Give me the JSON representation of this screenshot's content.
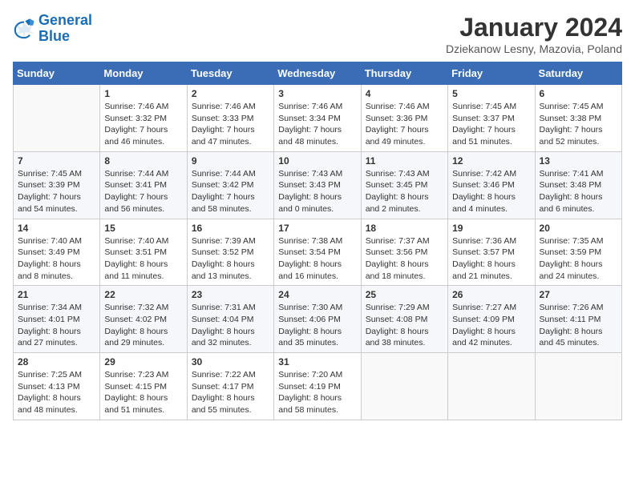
{
  "header": {
    "logo_general": "General",
    "logo_blue": "Blue",
    "month_title": "January 2024",
    "location": "Dziekanow Lesny, Mazovia, Poland"
  },
  "days_of_week": [
    "Sunday",
    "Monday",
    "Tuesday",
    "Wednesday",
    "Thursday",
    "Friday",
    "Saturday"
  ],
  "weeks": [
    [
      {
        "day": "",
        "sunrise": "",
        "sunset": "",
        "daylight": ""
      },
      {
        "day": "1",
        "sunrise": "Sunrise: 7:46 AM",
        "sunset": "Sunset: 3:32 PM",
        "daylight": "Daylight: 7 hours and 46 minutes."
      },
      {
        "day": "2",
        "sunrise": "Sunrise: 7:46 AM",
        "sunset": "Sunset: 3:33 PM",
        "daylight": "Daylight: 7 hours and 47 minutes."
      },
      {
        "day": "3",
        "sunrise": "Sunrise: 7:46 AM",
        "sunset": "Sunset: 3:34 PM",
        "daylight": "Daylight: 7 hours and 48 minutes."
      },
      {
        "day": "4",
        "sunrise": "Sunrise: 7:46 AM",
        "sunset": "Sunset: 3:36 PM",
        "daylight": "Daylight: 7 hours and 49 minutes."
      },
      {
        "day": "5",
        "sunrise": "Sunrise: 7:45 AM",
        "sunset": "Sunset: 3:37 PM",
        "daylight": "Daylight: 7 hours and 51 minutes."
      },
      {
        "day": "6",
        "sunrise": "Sunrise: 7:45 AM",
        "sunset": "Sunset: 3:38 PM",
        "daylight": "Daylight: 7 hours and 52 minutes."
      }
    ],
    [
      {
        "day": "7",
        "sunrise": "Sunrise: 7:45 AM",
        "sunset": "Sunset: 3:39 PM",
        "daylight": "Daylight: 7 hours and 54 minutes."
      },
      {
        "day": "8",
        "sunrise": "Sunrise: 7:44 AM",
        "sunset": "Sunset: 3:41 PM",
        "daylight": "Daylight: 7 hours and 56 minutes."
      },
      {
        "day": "9",
        "sunrise": "Sunrise: 7:44 AM",
        "sunset": "Sunset: 3:42 PM",
        "daylight": "Daylight: 7 hours and 58 minutes."
      },
      {
        "day": "10",
        "sunrise": "Sunrise: 7:43 AM",
        "sunset": "Sunset: 3:43 PM",
        "daylight": "Daylight: 8 hours and 0 minutes."
      },
      {
        "day": "11",
        "sunrise": "Sunrise: 7:43 AM",
        "sunset": "Sunset: 3:45 PM",
        "daylight": "Daylight: 8 hours and 2 minutes."
      },
      {
        "day": "12",
        "sunrise": "Sunrise: 7:42 AM",
        "sunset": "Sunset: 3:46 PM",
        "daylight": "Daylight: 8 hours and 4 minutes."
      },
      {
        "day": "13",
        "sunrise": "Sunrise: 7:41 AM",
        "sunset": "Sunset: 3:48 PM",
        "daylight": "Daylight: 8 hours and 6 minutes."
      }
    ],
    [
      {
        "day": "14",
        "sunrise": "Sunrise: 7:40 AM",
        "sunset": "Sunset: 3:49 PM",
        "daylight": "Daylight: 8 hours and 8 minutes."
      },
      {
        "day": "15",
        "sunrise": "Sunrise: 7:40 AM",
        "sunset": "Sunset: 3:51 PM",
        "daylight": "Daylight: 8 hours and 11 minutes."
      },
      {
        "day": "16",
        "sunrise": "Sunrise: 7:39 AM",
        "sunset": "Sunset: 3:52 PM",
        "daylight": "Daylight: 8 hours and 13 minutes."
      },
      {
        "day": "17",
        "sunrise": "Sunrise: 7:38 AM",
        "sunset": "Sunset: 3:54 PM",
        "daylight": "Daylight: 8 hours and 16 minutes."
      },
      {
        "day": "18",
        "sunrise": "Sunrise: 7:37 AM",
        "sunset": "Sunset: 3:56 PM",
        "daylight": "Daylight: 8 hours and 18 minutes."
      },
      {
        "day": "19",
        "sunrise": "Sunrise: 7:36 AM",
        "sunset": "Sunset: 3:57 PM",
        "daylight": "Daylight: 8 hours and 21 minutes."
      },
      {
        "day": "20",
        "sunrise": "Sunrise: 7:35 AM",
        "sunset": "Sunset: 3:59 PM",
        "daylight": "Daylight: 8 hours and 24 minutes."
      }
    ],
    [
      {
        "day": "21",
        "sunrise": "Sunrise: 7:34 AM",
        "sunset": "Sunset: 4:01 PM",
        "daylight": "Daylight: 8 hours and 27 minutes."
      },
      {
        "day": "22",
        "sunrise": "Sunrise: 7:32 AM",
        "sunset": "Sunset: 4:02 PM",
        "daylight": "Daylight: 8 hours and 29 minutes."
      },
      {
        "day": "23",
        "sunrise": "Sunrise: 7:31 AM",
        "sunset": "Sunset: 4:04 PM",
        "daylight": "Daylight: 8 hours and 32 minutes."
      },
      {
        "day": "24",
        "sunrise": "Sunrise: 7:30 AM",
        "sunset": "Sunset: 4:06 PM",
        "daylight": "Daylight: 8 hours and 35 minutes."
      },
      {
        "day": "25",
        "sunrise": "Sunrise: 7:29 AM",
        "sunset": "Sunset: 4:08 PM",
        "daylight": "Daylight: 8 hours and 38 minutes."
      },
      {
        "day": "26",
        "sunrise": "Sunrise: 7:27 AM",
        "sunset": "Sunset: 4:09 PM",
        "daylight": "Daylight: 8 hours and 42 minutes."
      },
      {
        "day": "27",
        "sunrise": "Sunrise: 7:26 AM",
        "sunset": "Sunset: 4:11 PM",
        "daylight": "Daylight: 8 hours and 45 minutes."
      }
    ],
    [
      {
        "day": "28",
        "sunrise": "Sunrise: 7:25 AM",
        "sunset": "Sunset: 4:13 PM",
        "daylight": "Daylight: 8 hours and 48 minutes."
      },
      {
        "day": "29",
        "sunrise": "Sunrise: 7:23 AM",
        "sunset": "Sunset: 4:15 PM",
        "daylight": "Daylight: 8 hours and 51 minutes."
      },
      {
        "day": "30",
        "sunrise": "Sunrise: 7:22 AM",
        "sunset": "Sunset: 4:17 PM",
        "daylight": "Daylight: 8 hours and 55 minutes."
      },
      {
        "day": "31",
        "sunrise": "Sunrise: 7:20 AM",
        "sunset": "Sunset: 4:19 PM",
        "daylight": "Daylight: 8 hours and 58 minutes."
      },
      {
        "day": "",
        "sunrise": "",
        "sunset": "",
        "daylight": ""
      },
      {
        "day": "",
        "sunrise": "",
        "sunset": "",
        "daylight": ""
      },
      {
        "day": "",
        "sunrise": "",
        "sunset": "",
        "daylight": ""
      }
    ]
  ]
}
